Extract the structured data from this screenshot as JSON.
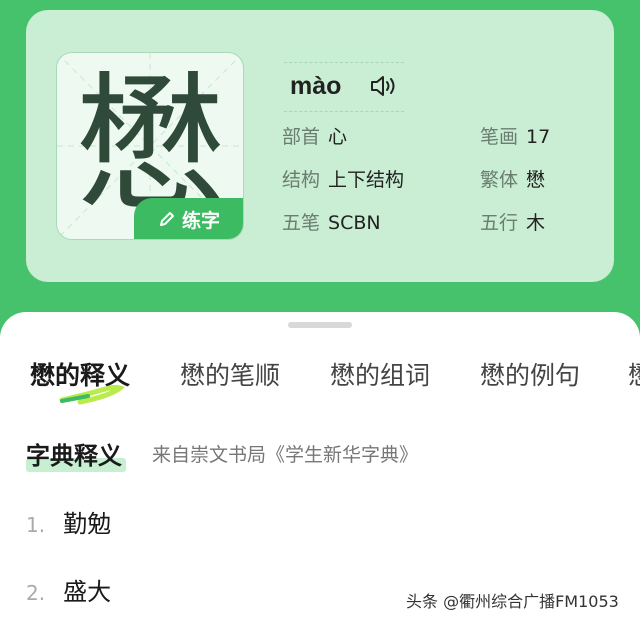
{
  "character": {
    "glyph": "懋",
    "practice_label": "练字",
    "pinyin": "mào"
  },
  "info": {
    "radical_key": "部首",
    "radical_value": "心",
    "strokes_key": "笔画",
    "strokes_value": "17",
    "structure_key": "结构",
    "structure_value": "上下结构",
    "traditional_key": "繁体",
    "traditional_value": "懋",
    "wubi_key": "五笔",
    "wubi_value": "SCBN",
    "wuxing_key": "五行",
    "wuxing_value": "木"
  },
  "tabs": [
    "懋的释义",
    "懋的笔顺",
    "懋的组词",
    "懋的例句",
    "懋"
  ],
  "dictionary": {
    "title": "字典释义",
    "source": "来自崇文书局《学生新华字典》",
    "definitions": [
      {
        "num": "1.",
        "text": "勤勉"
      },
      {
        "num": "2.",
        "text": "盛大"
      }
    ]
  },
  "watermark": "头条 @衢州综合广播FM1053",
  "colors": {
    "background": "#45c26b",
    "card": "#c9eed4",
    "accent": "#3dbb63",
    "highlight": "#c7efd1"
  }
}
